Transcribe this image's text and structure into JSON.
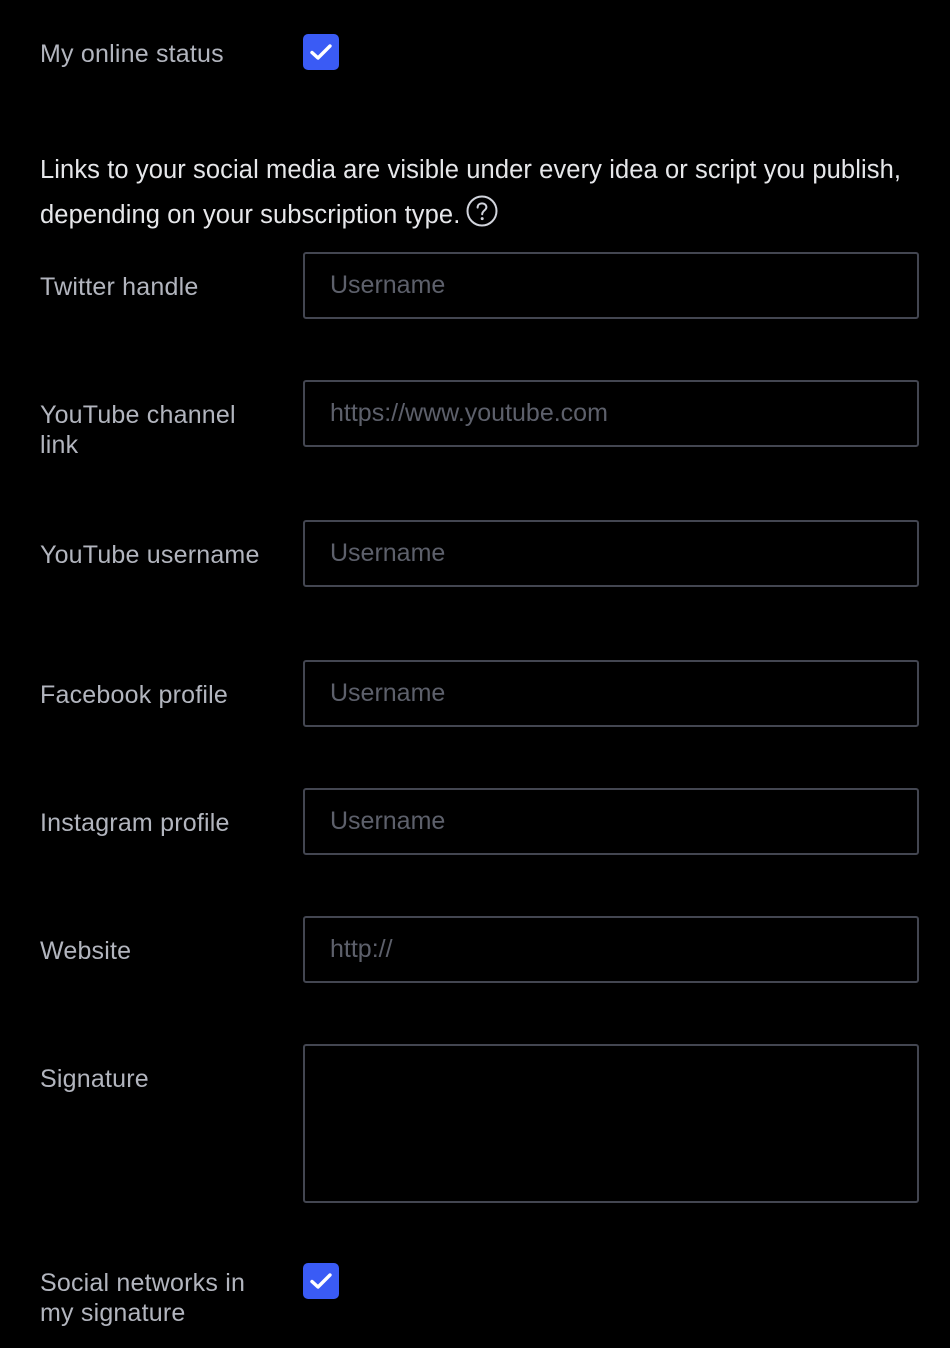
{
  "online_status": {
    "label": "My online status",
    "checked": true
  },
  "social_info": {
    "text": "Links to your social media are visible under every idea or script you publish, depending on your subscription type.",
    "help_icon": "question-circle-icon"
  },
  "fields": {
    "twitter": {
      "label": "Twitter handle",
      "placeholder": "Username",
      "value": ""
    },
    "youtube_channel": {
      "label": "YouTube channel link",
      "placeholder": "https://www.youtube.com",
      "value": ""
    },
    "youtube_username": {
      "label": "YouTube username",
      "placeholder": "Username",
      "value": ""
    },
    "facebook": {
      "label": "Facebook profile",
      "placeholder": "Username",
      "value": ""
    },
    "instagram": {
      "label": "Instagram profile",
      "placeholder": "Username",
      "value": ""
    },
    "website": {
      "label": "Website",
      "placeholder": "http://",
      "value": ""
    },
    "signature": {
      "label": "Signature",
      "placeholder": "",
      "value": ""
    }
  },
  "social_in_signature": {
    "label": "Social networks in my signature",
    "checked": true
  },
  "colors": {
    "background": "#000000",
    "accent": "#3a5bf5",
    "border": "#434651",
    "label": "#b2b5be",
    "placeholder": "#5d606b"
  }
}
